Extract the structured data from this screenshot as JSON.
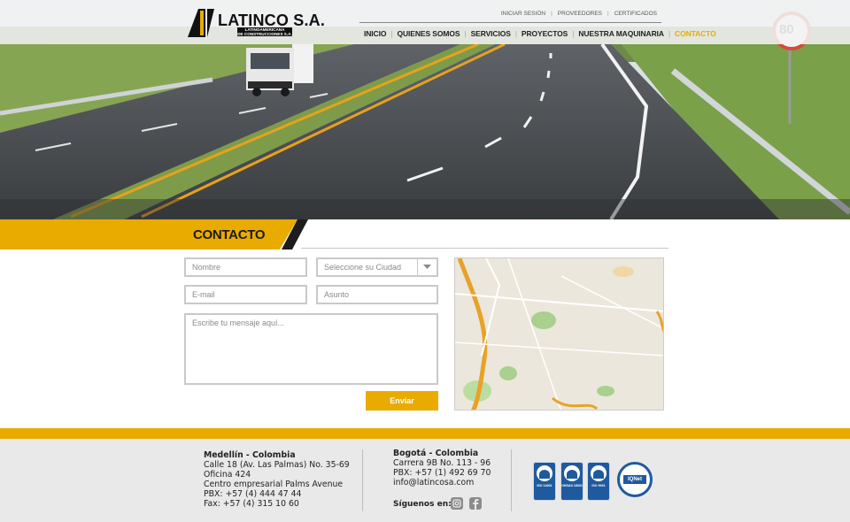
{
  "brand": {
    "name": "LATINCO S.A.",
    "subtitle_line1": "LATINOAMERICANA",
    "subtitle_line2": "DE CONSTRUCCIONES S.A."
  },
  "utility_nav": [
    "INICIAR SESIÓN",
    "PROVEEDORES",
    "CERTIFICADOS"
  ],
  "main_nav": [
    {
      "label": "INICIO",
      "active": false
    },
    {
      "label": "QUIENES SOMOS",
      "active": false
    },
    {
      "label": "SERVICIOS",
      "active": false
    },
    {
      "label": "PROYECTOS",
      "active": false
    },
    {
      "label": "NUESTRA MAQUINARIA",
      "active": false
    },
    {
      "label": "CONTACTO",
      "active": true
    }
  ],
  "hero": {
    "speed_sign": "80"
  },
  "section": {
    "title": "CONTACTO"
  },
  "form": {
    "name_placeholder": "Nombre",
    "city_placeholder": "Seleccione su Ciudad",
    "email_placeholder": "E-mail",
    "subject_placeholder": "Asunto",
    "message_placeholder": "Escribe tu mensaje aquí...",
    "submit_label": "Enviar"
  },
  "footer": {
    "medellin": {
      "heading": "Medellín - Colombia",
      "lines": [
        "Calle 18 (Av. Las Palmas) No. 35-69",
        "Oficina 424",
        "Centro empresarial Palms Avenue",
        "PBX: +57 (4) 444 47 44",
        "Fax: +57 (4) 315 10 60"
      ]
    },
    "bogota": {
      "heading": "Bogotá - Colombia",
      "lines": [
        "Carrera 9B No. 113 - 96",
        "PBX: +57 (1) 492 69 70",
        "info@latincosa.com"
      ]
    },
    "follow_label": "Síguenos en:",
    "social_icons": [
      "instagram-icon",
      "facebook-icon"
    ],
    "certifications": [
      {
        "label": "ISO 14001"
      },
      {
        "label": "OHSAS 18001"
      },
      {
        "label": "ISO 9001"
      }
    ],
    "iqnet_label": "IQNet"
  },
  "colors": {
    "accent": "#e9ab00",
    "dark": "#1d1d1d",
    "cert_blue": "#1f5a9f"
  }
}
